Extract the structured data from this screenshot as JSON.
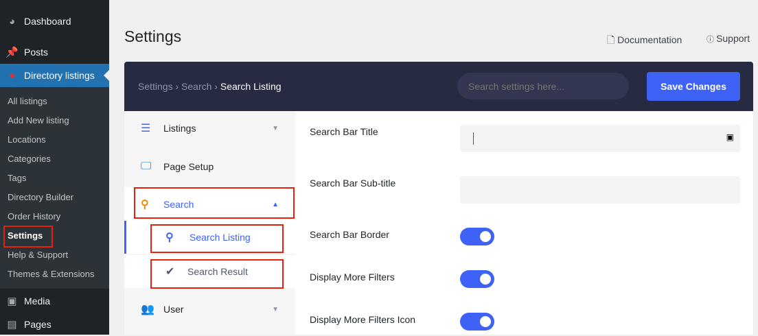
{
  "wp_menu": {
    "dashboard": "Dashboard",
    "posts": "Posts",
    "directory": "Directory listings",
    "media": "Media",
    "pages": "Pages",
    "sub": [
      "All listings",
      "Add New listing",
      "Locations",
      "Categories",
      "Tags",
      "Directory Builder",
      "Order History",
      "Settings",
      "Help & Support",
      "Themes & Extensions"
    ]
  },
  "page_title": "Settings",
  "links": {
    "documentation": "Documentation",
    "support": "Support"
  },
  "breadcrumb": {
    "l1": "Settings",
    "l2": "Search",
    "current": "Search Listing"
  },
  "search": {
    "placeholder": "Search settings here..."
  },
  "save_label": "Save Changes",
  "nav": {
    "listings": "Listings",
    "page_setup": "Page Setup",
    "search": "Search",
    "search_listing": "Search Listing",
    "search_result": "Search Result",
    "user": "User"
  },
  "fields": {
    "title": "Search Bar Title",
    "subtitle": "Search Bar Sub-title",
    "border": "Search Bar Border",
    "more_filters": "Display More Filters",
    "more_filters_icon": "Display More Filters Icon"
  },
  "toggles": {
    "border": true,
    "more_filters": true,
    "more_filters_icon": true
  }
}
